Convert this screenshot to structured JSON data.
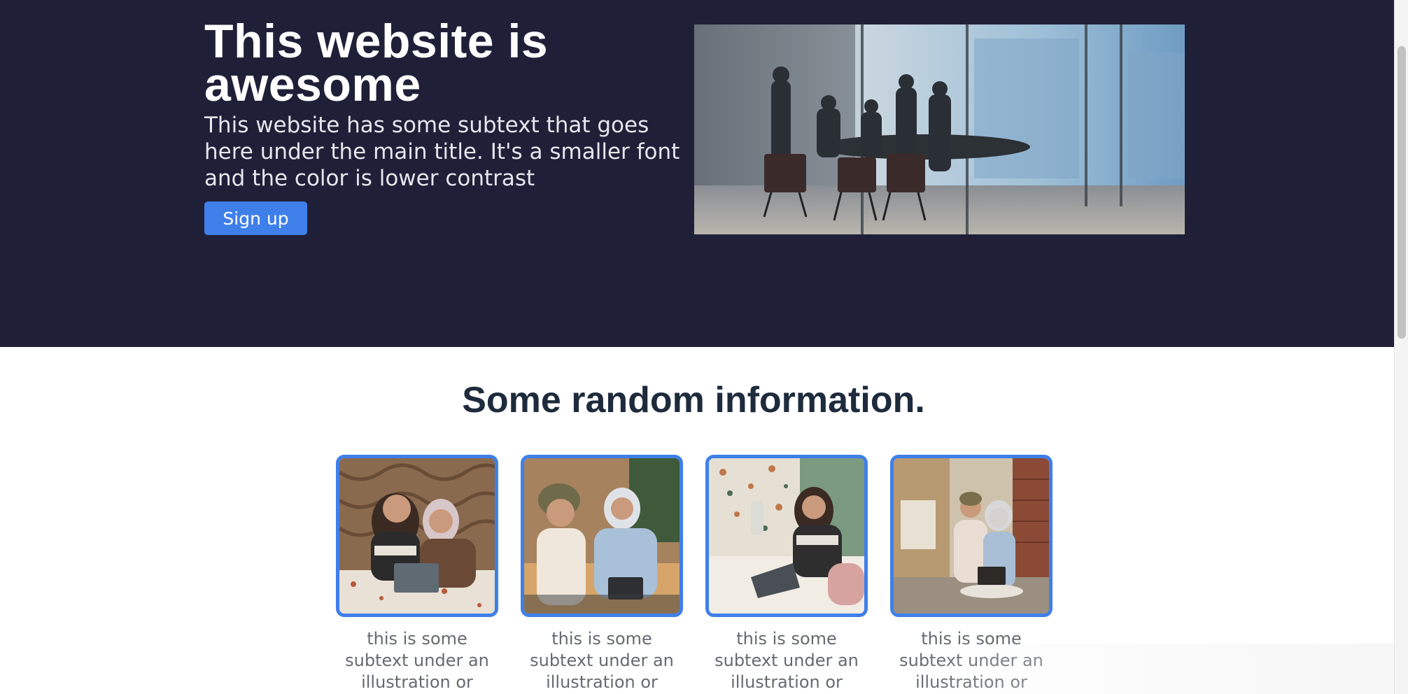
{
  "hero": {
    "title": "This website is awesome",
    "subtitle": "This website has some subtext that goes here under the main title. It's a smaller font and the color is lower contrast",
    "signup_label": "Sign up",
    "image_subject": "business-meeting-photo"
  },
  "info": {
    "heading": "Some random information.",
    "cards": [
      {
        "caption": "this is some subtext under an illustration or image",
        "image_subject": "two-women-laptop-photo"
      },
      {
        "caption": "this is some subtext under an illustration or image",
        "image_subject": "two-women-tablet-photo"
      },
      {
        "caption": "this is some subtext under an illustration or image",
        "image_subject": "woman-laptop-cafe-photo"
      },
      {
        "caption": "this is some subtext under an illustration or image",
        "image_subject": "two-women-laptop-patio-photo"
      }
    ]
  },
  "colors": {
    "hero_bg": "#1f2038",
    "accent": "#3f7fea",
    "heading_dark": "#1e2b3c",
    "caption_gray": "#666a70"
  }
}
